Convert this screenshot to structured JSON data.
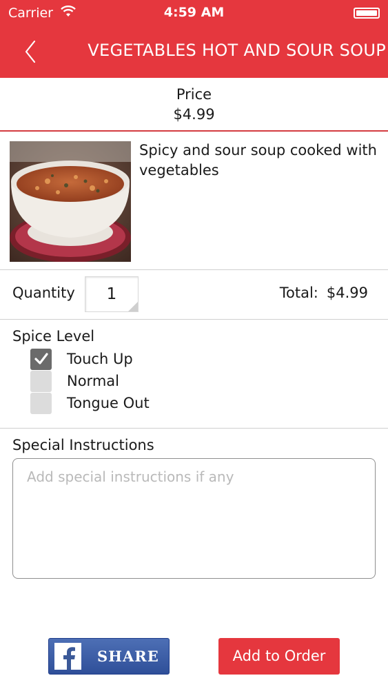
{
  "status_bar": {
    "carrier": "Carrier",
    "time": "4:59 AM"
  },
  "nav": {
    "back_icon": "chevron-left-icon",
    "title": "VEGETABLES HOT AND SOUR SOUP"
  },
  "price": {
    "label": "Price",
    "value": "$4.99"
  },
  "item": {
    "description": "Spicy and sour soup cooked with vegetables"
  },
  "quantity": {
    "label": "Quantity",
    "value": "1",
    "total_label": "Total:",
    "total_value": "$4.99"
  },
  "spice": {
    "title": "Spice Level",
    "options": [
      {
        "label": "Touch Up",
        "checked": true
      },
      {
        "label": "Normal",
        "checked": false
      },
      {
        "label": "Tongue Out",
        "checked": false
      }
    ]
  },
  "instructions": {
    "title": "Special Instructions",
    "placeholder": "Add special instructions if any"
  },
  "actions": {
    "share_label": "SHARE",
    "add_label": "Add to Order"
  },
  "colors": {
    "brand_red": "#e5373e",
    "facebook_blue": "#3b5998"
  }
}
